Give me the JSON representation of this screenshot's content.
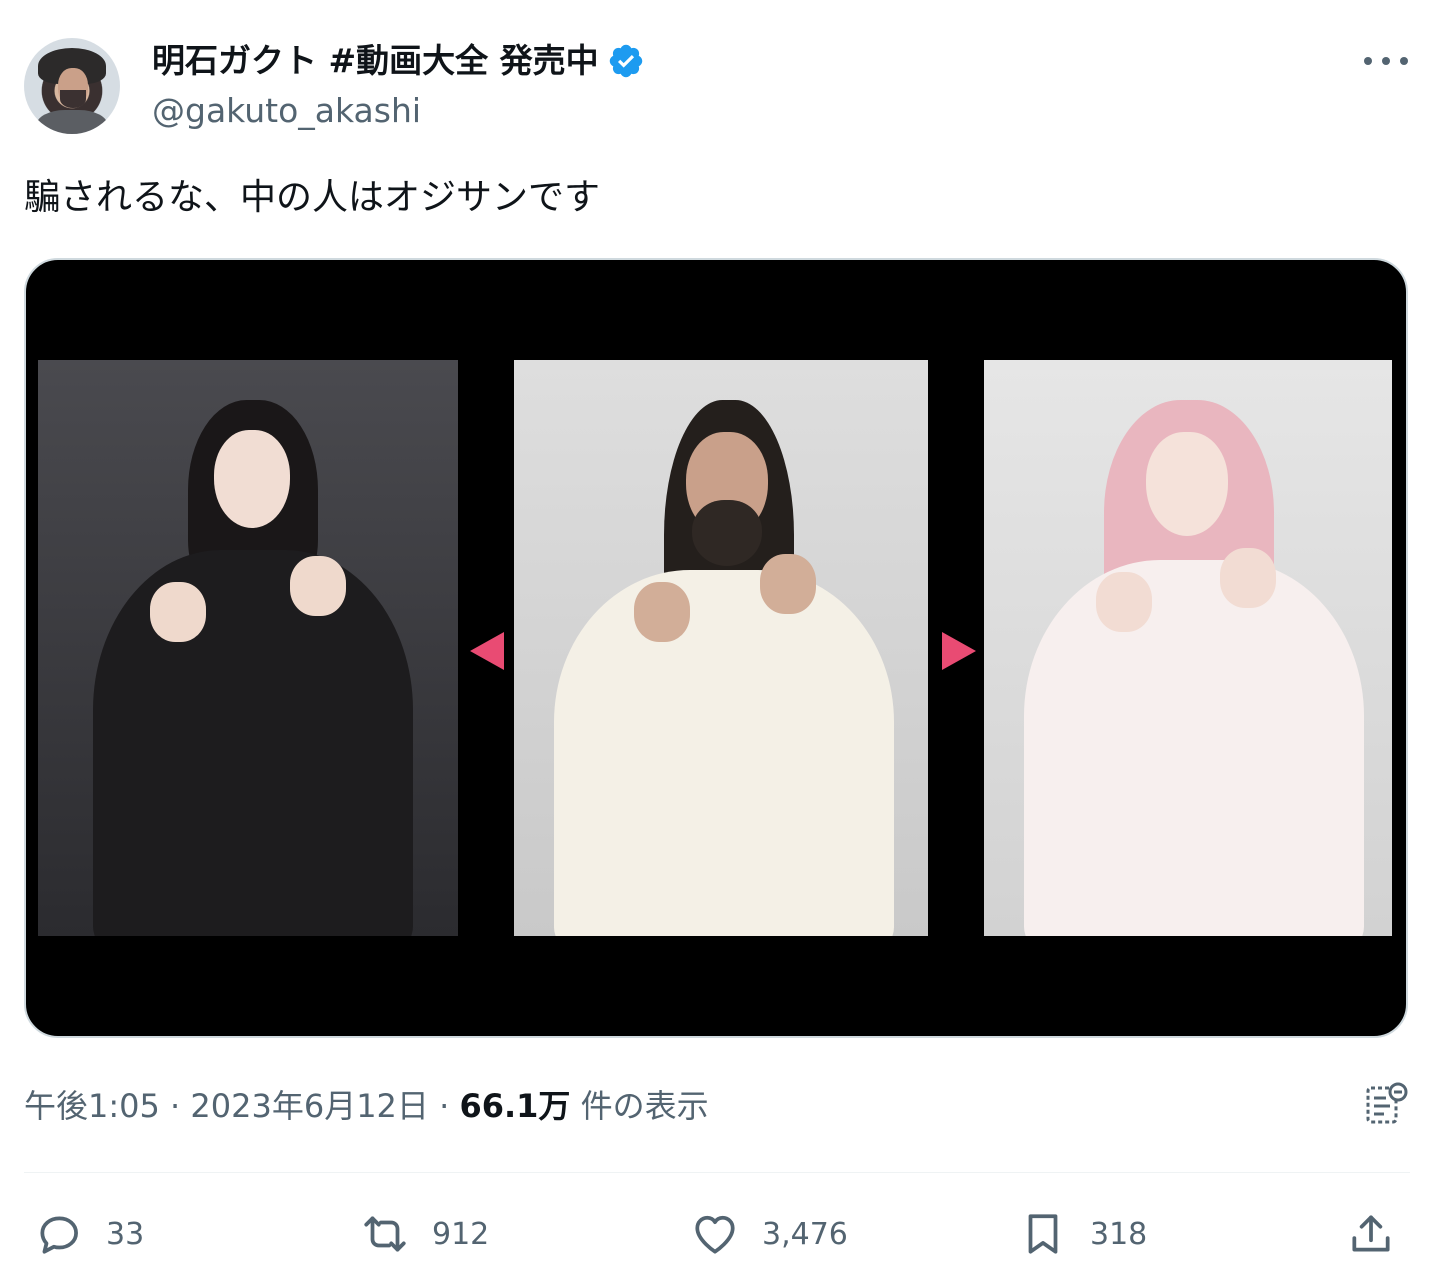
{
  "author": {
    "display_name": "明石ガクト #動画大全 発売中",
    "handle": "@gakuto_akashi",
    "verified_color": "#1d9bf0"
  },
  "tweet": {
    "text": "騙されるな、中の人はオジサンです"
  },
  "media": {
    "arrow_color": "#e94b73"
  },
  "meta": {
    "time": "午後1:05",
    "sep1": " · ",
    "date": "2023年6月12日",
    "sep2": " · ",
    "views_count": "66.1万",
    "views_label": " 件の表示"
  },
  "actions": {
    "replies": "33",
    "retweets": "912",
    "likes": "3,476",
    "bookmarks": "318"
  },
  "icons": [
    "more-icon",
    "verified-badge-icon",
    "analytics-icon",
    "reply-icon",
    "retweet-icon",
    "like-icon",
    "bookmark-icon",
    "share-icon"
  ]
}
